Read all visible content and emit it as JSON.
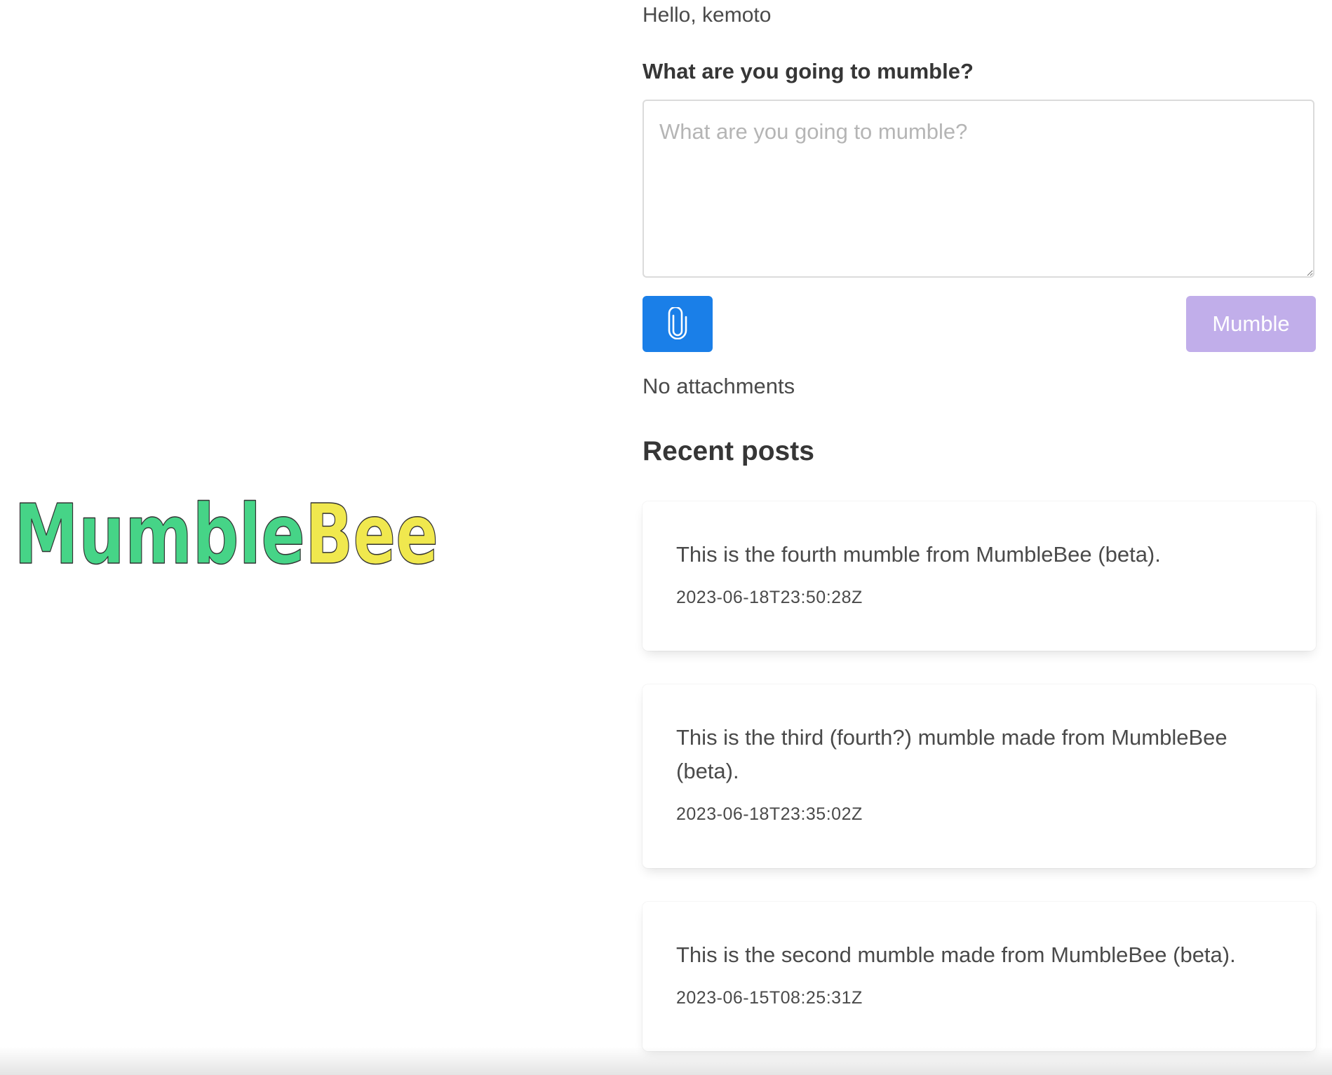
{
  "brand": {
    "logo_text": "MumbleBee",
    "logo_part1": "Mumble",
    "logo_part2": "Bee",
    "colors": {
      "mumble": "#46d487",
      "bee": "#f0e84e",
      "outline": "#333333"
    }
  },
  "header": {
    "greeting": "Hello, kemoto"
  },
  "composer": {
    "label": "What are you going to mumble?",
    "placeholder": "What are you going to mumble?",
    "value": "",
    "attach_icon": "paperclip-icon",
    "attach_color": "#1a7fe8",
    "submit_label": "Mumble",
    "submit_color": "#c1aeea",
    "attachments_status": "No attachments"
  },
  "recent": {
    "heading": "Recent posts",
    "posts": [
      {
        "text": "This is the fourth mumble from MumbleBee (beta).",
        "timestamp": "2023-06-18T23:50:28Z"
      },
      {
        "text": "This is the third (fourth?) mumble made from MumbleBee (beta).",
        "timestamp": "2023-06-18T23:35:02Z"
      },
      {
        "text": "This is the second mumble made from MumbleBee (beta).",
        "timestamp": "2023-06-15T08:25:31Z"
      }
    ]
  }
}
